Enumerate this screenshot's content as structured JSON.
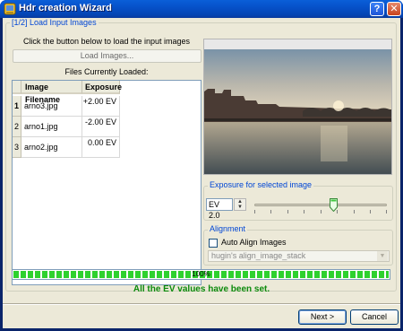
{
  "window": {
    "title": "Hdr creation Wizard",
    "help_label": "?",
    "close_label": "✕"
  },
  "step_title": "[1/2] Load Input Images",
  "instruction": "Click the button below to load the input images",
  "load_button_label": "Load Images...",
  "files_label": "Files Currently Loaded:",
  "table": {
    "headers": [
      "Image Filename",
      "Exposure"
    ],
    "rows": [
      {
        "index": "1",
        "filename": "arno3.jpg",
        "exposure": "+2.00 EV"
      },
      {
        "index": "2",
        "filename": "arno1.jpg",
        "exposure": "-2.00 EV"
      },
      {
        "index": "3",
        "filename": "arno2.jpg",
        "exposure": "0.00 EV"
      }
    ]
  },
  "exposure_group": {
    "title": "Exposure for selected image",
    "value": "EV 2.0",
    "slider_level": 0.6
  },
  "alignment_group": {
    "title": "Alignment",
    "auto_align_label": "Auto Align Images",
    "auto_align_checked": false,
    "tool_selected": "hugin's align_image_stack"
  },
  "progress": {
    "percent": 100,
    "label": "100%"
  },
  "status_message": "All the EV values have been set.",
  "buttons": {
    "next": "Next >",
    "cancel": "Cancel"
  },
  "colors": {
    "accent": "#0046d5",
    "status": "#0c8a0c",
    "progress": "#2ed12e"
  },
  "icons": [
    "wizard-app-icon",
    "help-icon",
    "close-icon",
    "spin-up-icon",
    "spin-down-icon",
    "slider-thumb-icon",
    "dropdown-arrow-icon"
  ]
}
